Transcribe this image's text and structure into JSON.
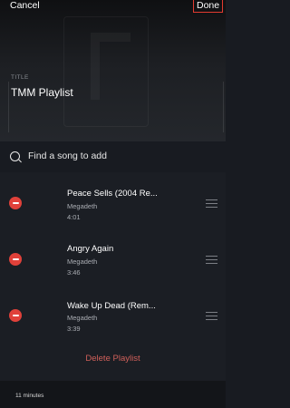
{
  "nav": {
    "cancel_label": "Cancel",
    "done_label": "Done"
  },
  "title_field": {
    "label": "TITLE",
    "value": "TMM Playlist"
  },
  "search": {
    "placeholder": "Find a song to add",
    "icon": "search-icon"
  },
  "songs": [
    {
      "title": "Peace Sells (2004 Re...",
      "artist": "Megadeth",
      "duration": "4:01"
    },
    {
      "title": "Angry Again",
      "artist": "Megadeth",
      "duration": "3:46"
    },
    {
      "title": "Wake Up Dead (Rem...",
      "artist": "Megadeth",
      "duration": "3:39"
    }
  ],
  "delete_label": "Delete Playlist",
  "footer": {
    "total_duration": "11 minutes"
  },
  "colors": {
    "accent_red": "#e0413a",
    "delete_text": "#d0605a",
    "background": "#181b21"
  }
}
